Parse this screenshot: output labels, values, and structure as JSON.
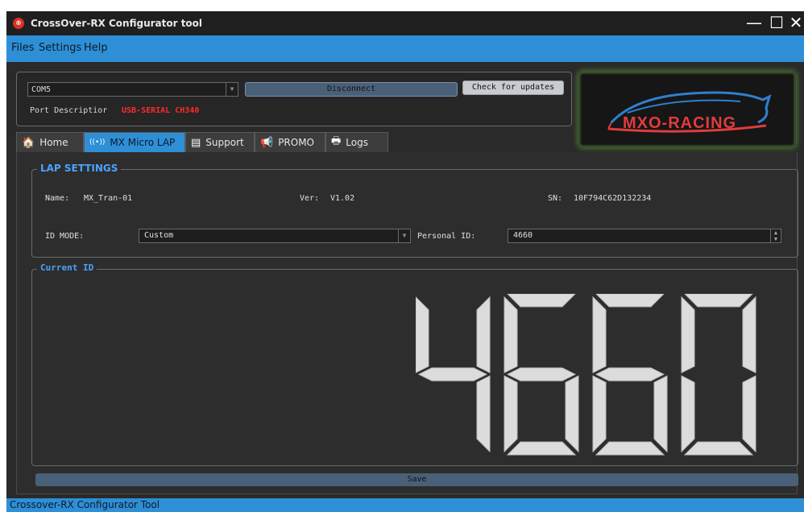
{
  "window": {
    "title": "CrossOver-RX Configurator tool",
    "app_icon": "app-logo-icon",
    "controls": {
      "minimize": "—",
      "maximize": "☐",
      "close": "✕"
    }
  },
  "menu": {
    "items": [
      "Files",
      "Settings",
      "Help"
    ]
  },
  "connection": {
    "port": "COM5",
    "disconnect_label": "Disconnect",
    "updates_label": "Check for updates",
    "port_desc_label": "Port Descriptior",
    "port_desc_value": "USB-SERIAL CH340"
  },
  "logo": {
    "text": "MXO-RACING"
  },
  "tabs": [
    {
      "label": "Home",
      "icon": "home-icon",
      "glyph": "🏠"
    },
    {
      "label": "MX Micro LAP",
      "icon": "wireless-icon",
      "glyph": "((•))"
    },
    {
      "label": "Support",
      "icon": "document-icon",
      "glyph": "▤"
    },
    {
      "label": "PROMO",
      "icon": "megaphone-icon",
      "glyph": "📢"
    },
    {
      "label": "Logs",
      "icon": "printer-icon",
      "glyph": "🖶"
    }
  ],
  "lap_settings": {
    "title": "LAP SETTINGS",
    "name_label": "Name:",
    "name_value": "MX_Tran-01",
    "ver_label": "Ver:",
    "ver_value": "V1.02",
    "sn_label": "SN:",
    "sn_value": "10F794C62D132234",
    "id_mode_label": "ID MODE:",
    "id_mode_value": "Custom",
    "personal_id_label": "Personal ID:",
    "personal_id_value": "4660"
  },
  "current_id": {
    "title": "Current ID",
    "value": "4660"
  },
  "save_label": "Save",
  "status": {
    "text": "Crossover-RX Configurator Tool"
  },
  "colors": {
    "accent": "#2e8fd6",
    "background": "#2d2d2d",
    "port_desc": "#ff2a2a",
    "group_title": "#4aa3ff",
    "segment": "#dcdcdc"
  }
}
